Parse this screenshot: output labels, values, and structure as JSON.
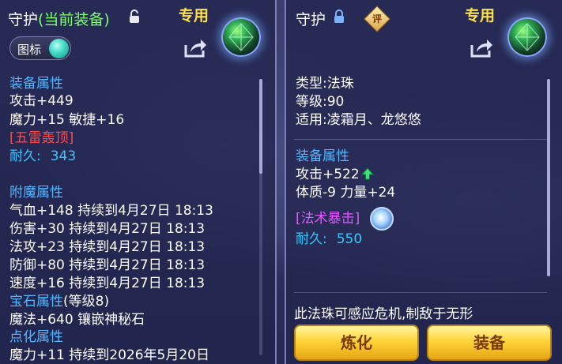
{
  "left": {
    "title_main": "守护",
    "title_paren": "(当前装备)",
    "exclusive": "专用",
    "toggle_label": "图标",
    "lines": {
      "attr_header": "装备属性",
      "attack": "攻击+449",
      "magic_agility": "魔力+15 敏捷+16",
      "special_skill": "[五雷轰顶]",
      "durability_label": "耐久:",
      "durability_value": "343",
      "enchant_header": "附魔属性",
      "ench1": "气血+148 持续到4月27日 18:13",
      "ench2": "伤害+30 持续到4月27日 18:13",
      "ench3": "法攻+23 持续到4月27日 18:13",
      "ench4": "防御+80 持续到4月27日 18:13",
      "ench5": "速度+16 持续到4月27日 18:13",
      "gem_header": "宝石属性",
      "gem_level": "(等级8)",
      "gem_line": "魔法+640 镶嵌神秘石",
      "point_header": "点化属性",
      "point_line": "魔力+11 持续到2026年5月20日"
    }
  },
  "right": {
    "title_main": "守护",
    "badge": "评",
    "exclusive": "专用",
    "lines": {
      "type": "类型:法珠",
      "level": "等级:90",
      "applicable": "适用:凌霜月、龙悠悠",
      "attr_header": "装备属性",
      "attack": "攻击+522",
      "con_str": "体质-9 力量+24",
      "special_skill": "[法术暴击]",
      "durability_label": "耐久:",
      "durability_value": "550"
    },
    "description": "此法珠可感应危机,制敌于无形",
    "buttons": {
      "refine": "炼化",
      "equip": "装备"
    }
  },
  "colors": {
    "section": "#58b6ff",
    "special": "#ff4a4a",
    "skill_purple": "#e15bff",
    "durability": "#38c8ff",
    "exclusive": "#ffe04a",
    "button": "#ffd43a"
  }
}
